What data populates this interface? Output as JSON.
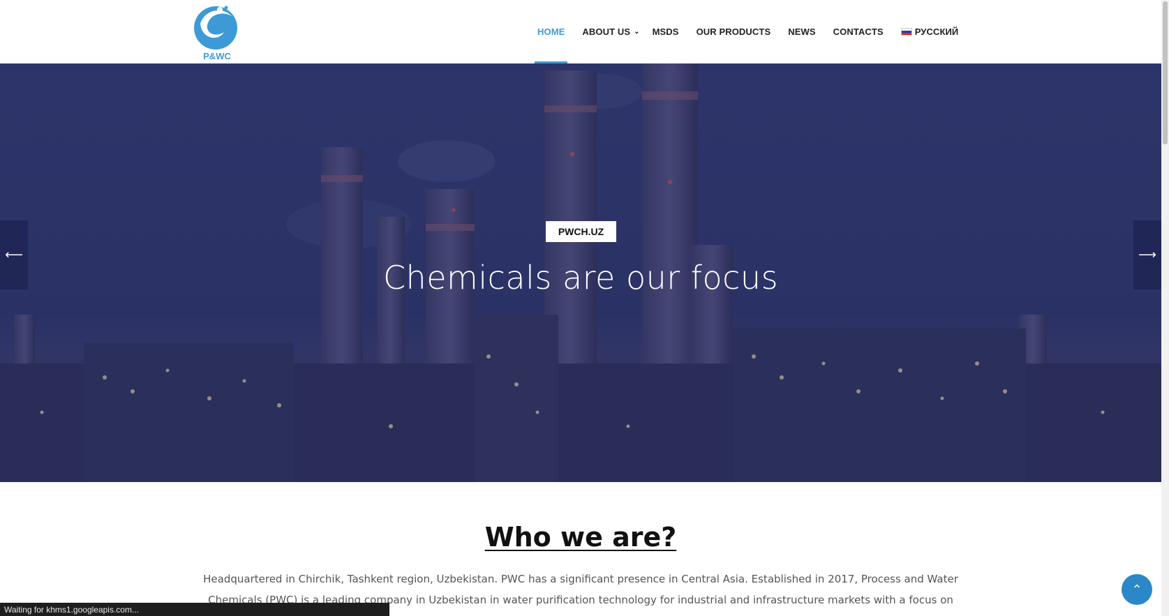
{
  "header": {
    "logo_text": "P&WC",
    "nav": [
      {
        "label": "HOME",
        "active": true
      },
      {
        "label": "ABOUT US",
        "has_dropdown": true
      },
      {
        "label": "MSDS"
      },
      {
        "label": "OUR PRODUCTS"
      },
      {
        "label": "NEWS"
      },
      {
        "label": "CONTACTS"
      },
      {
        "label": "РУССКИЙ",
        "flag": "ru-flag-icon"
      }
    ]
  },
  "hero": {
    "badge": "PWCH.UZ",
    "headline": "Chemicals are our focus",
    "prev_arrow": "⟵",
    "next_arrow": "⟶"
  },
  "about": {
    "title": "Who we are?",
    "text": "Headquartered in Chirchik, Tashkent region, Uzbekistan. PWC has a significant presence in Central Asia. Established in 2017, Process and Water Chemicals (PWC) is a leading company in Uzbekistan in water purification technology for industrial and infrastructure markets with a focus on chemicals for water recycle and"
  },
  "status_bar": "Waiting for khms1.googleapis.com...",
  "colors": {
    "accent": "#3d9ad6",
    "hero_overlay": "#2e3565",
    "scroll_top_button": "#2a87c8"
  }
}
